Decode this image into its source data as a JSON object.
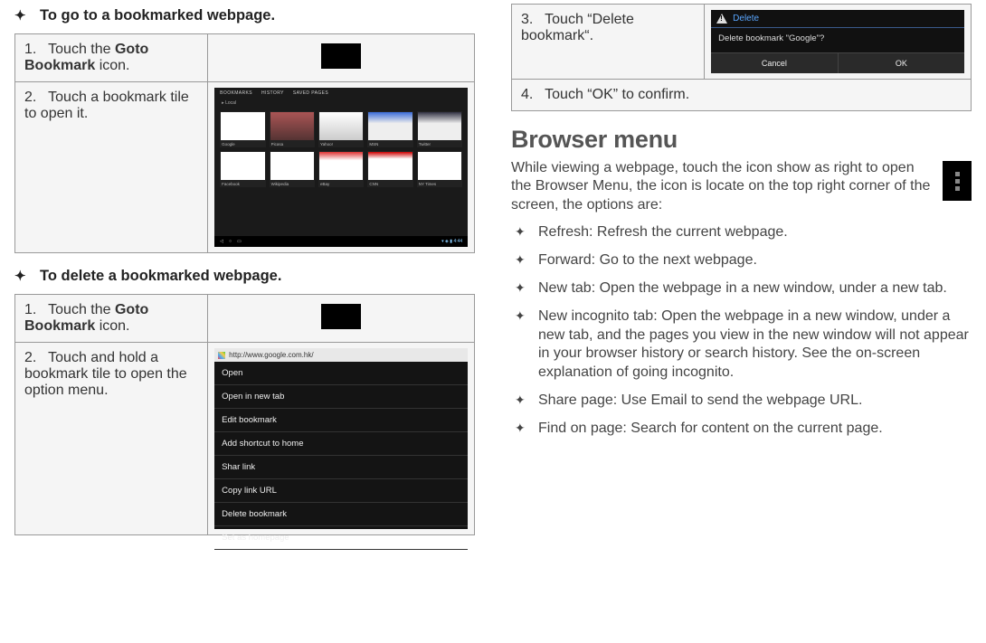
{
  "left": {
    "heading_goto": "To go to a bookmarked webpage.",
    "goto_steps": {
      "s1_num": "1.",
      "s1_a": "Touch the ",
      "s1_b": "Goto Bookmark",
      "s1_c": " icon.",
      "s2_num": "2.",
      "s2": "Touch a bookmark tile to open it."
    },
    "heading_delete": "To delete a bookmarked webpage.",
    "delete_steps": {
      "s1_num": "1.",
      "s1_a": "Touch the ",
      "s1_b": "Goto Bookmark",
      "s1_c": " icon.",
      "s2_num": "2.",
      "s2": "Touch and hold a bookmark tile to open the option menu."
    },
    "bm_tabs": [
      "BOOKMARKS",
      "HISTORY",
      "SAVED PAGES"
    ],
    "bm_local": "Local",
    "bm_tiles": [
      "Google",
      "Picasa",
      "Yahoo!",
      "MSN",
      "Twitter",
      "Facebook",
      "Wikipedia",
      "eBay",
      "CNN",
      "NY Times"
    ],
    "bm_time": "4:44",
    "ctx_url": "http://www.google.com.hk/",
    "ctx_items": [
      "Open",
      "Open in new tab",
      "Edit bookmark",
      "Add shortcut to home",
      "Shar link",
      "Copy link URL",
      "Delete bookmark",
      "Set as homepage"
    ]
  },
  "right": {
    "del_step_num": "3.",
    "del_step": "Touch “Delete bookmark“.",
    "del_title": "Delete",
    "del_msg": "Delete bookmark \"Google\"?",
    "del_cancel": "Cancel",
    "del_ok": "OK",
    "ok_step_num": "4.",
    "ok_step": "Touch “OK” to confirm.",
    "section": "Browser menu",
    "para": "While viewing a webpage, touch the icon show as right to open the Browser Menu, the icon is locate on the top right corner of the screen, the options are:",
    "items": [
      "Refresh: Refresh the current webpage.",
      "Forward: Go to the next webpage.",
      "New tab: Open the webpage in a new window, under a new tab.",
      "New incognito tab: Open the webpage in a new window, under a new tab, and the pages you view in the new window will not appear in your browser history or search history. See the on-screen explanation of going incognito.",
      "Share page: Use Email to send the webpage URL.",
      "Find on page: Search for content on the current page."
    ]
  }
}
